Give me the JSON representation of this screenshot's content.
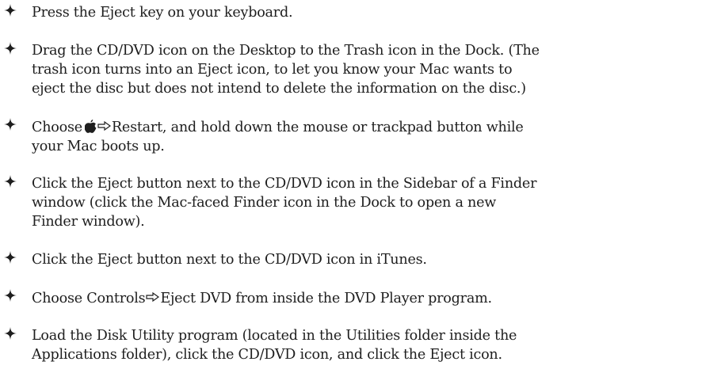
{
  "bullet_icon": "four-point-star-icon",
  "items": [
    {
      "lines": "Press the Eject key on your keyboard."
    },
    {
      "lines": "Drag the CD/DVD icon on the Desktop to the Trash icon in the Dock. (The\ntrash icon turns into an Eject icon, to let you know your Mac wants to\neject the disc but does not intend to delete the information on the disc.)"
    },
    {
      "prefix": "Choose",
      "icon": "apple-menu-icon",
      "arrow": "menu-arrow-icon",
      "suffix": "Restart, and hold down the mouse or trackpad button while\nyour Mac boots up."
    },
    {
      "lines": "Click the Eject button next to the CD/DVD icon in the Sidebar of a Finder\nwindow (click the Mac-faced Finder icon in the Dock to open a new\nFinder window)."
    },
    {
      "lines": "Click the Eject button next to the CD/DVD icon in iTunes."
    },
    {
      "prefix": "Choose Controls",
      "arrow": "menu-arrow-icon",
      "suffix": "Eject DVD from inside the DVD Player program."
    },
    {
      "lines": "Load the Disk Utility program (located in the Utilities folder inside the\nApplications folder), click the CD/DVD icon, and click the Eject icon."
    }
  ]
}
